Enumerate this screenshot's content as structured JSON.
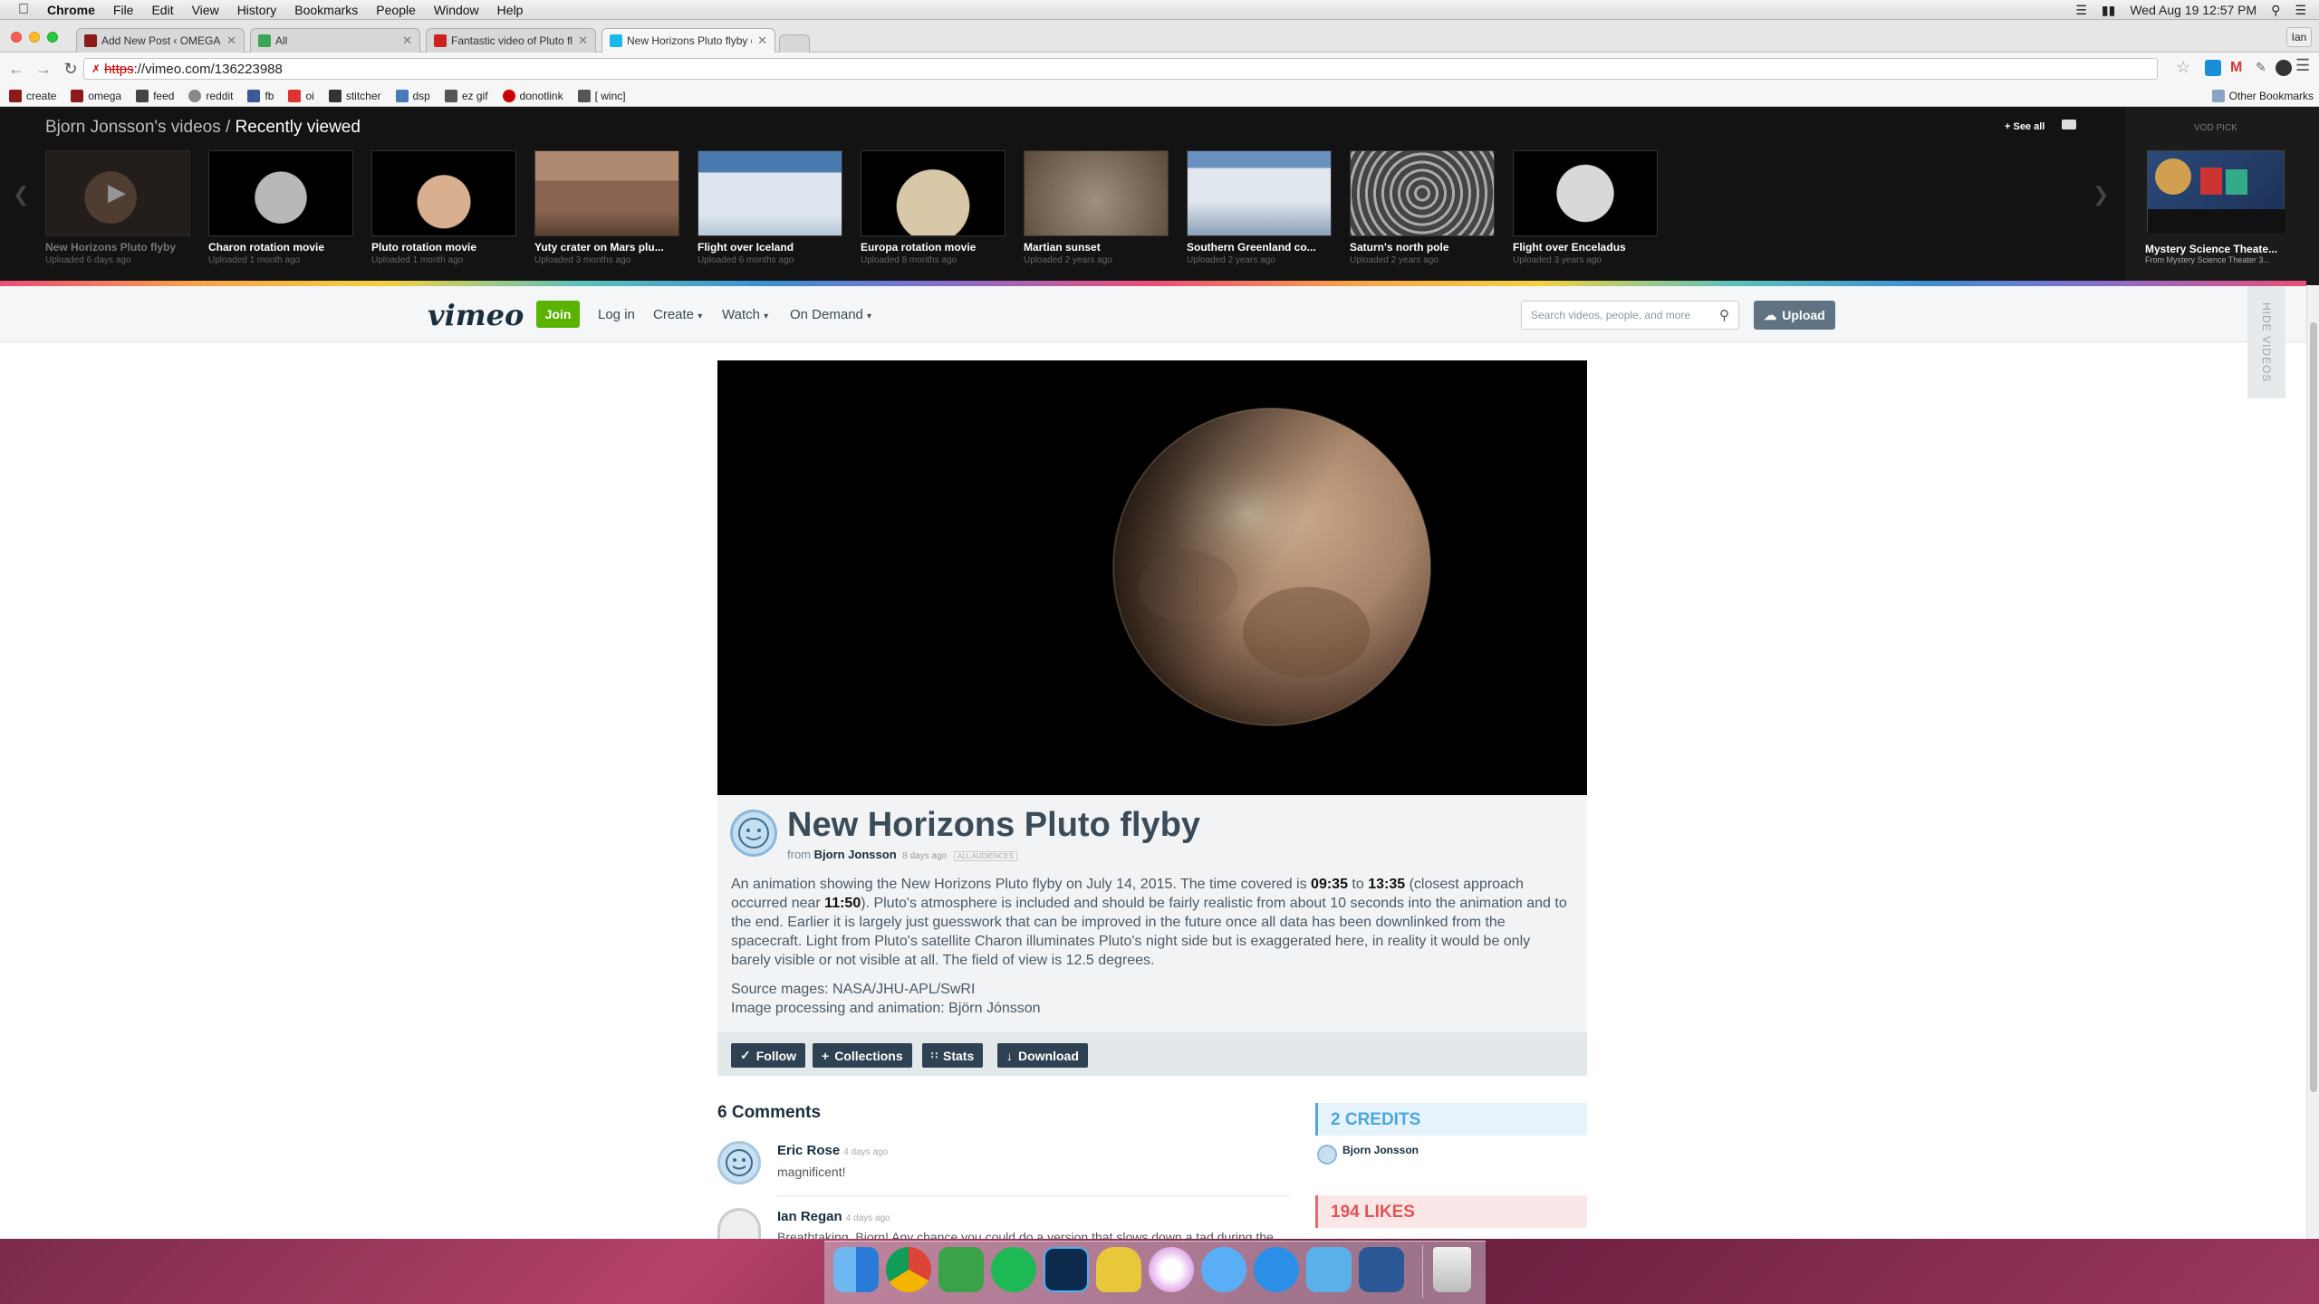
{
  "menubar": {
    "app": "Chrome",
    "items": [
      "File",
      "Edit",
      "View",
      "History",
      "Bookmarks",
      "People",
      "Window",
      "Help"
    ],
    "clock": "Wed Aug 19  12:57 PM"
  },
  "chrome": {
    "profile": "Ian",
    "tabs": [
      {
        "title": "Add New Post ‹ OMEGA-LI",
        "color": "#8b1a1a"
      },
      {
        "title": "All",
        "color": "#3aa655"
      },
      {
        "title": "Fantastic video of Pluto fly",
        "color": "#cc2222"
      },
      {
        "title": "New Horizons Pluto flyby o",
        "color": "#1ab7ea"
      }
    ],
    "url_scheme": "https",
    "url_rest": "://vimeo.com/136223988",
    "bookmarks": [
      {
        "label": "create",
        "color": "#8b1a1a"
      },
      {
        "label": "omega",
        "color": "#8b1a1a"
      },
      {
        "label": "feed",
        "color": "#444"
      },
      {
        "label": "reddit",
        "color": "#888"
      },
      {
        "label": "fb",
        "color": "#3b5998"
      },
      {
        "label": "oi",
        "color": "#d33"
      },
      {
        "label": "stitcher",
        "color": "#333"
      },
      {
        "label": "dsp",
        "color": "#4a7bb7"
      },
      {
        "label": "ez gif",
        "color": "#555"
      },
      {
        "label": "donotlink",
        "color": "#c00"
      },
      {
        "label": "[ winc]",
        "color": "#555"
      }
    ],
    "other_bookmarks": "Other Bookmarks"
  },
  "strip": {
    "owner": "Bjorn Jonsson's videos",
    "sep": " / ",
    "current": "Recently viewed",
    "see_all": "+ See all",
    "vod_label": "VOD PICK",
    "vod_title": "Mystery Science Theate...",
    "vod_from": "From Mystery Science Theater 3...",
    "videos": [
      {
        "title": "New Horizons Pluto flyby",
        "uploaded": "Uploaded 6 days ago",
        "style": "pluto-dim"
      },
      {
        "title": "Charon rotation movie",
        "uploaded": "Uploaded 1 month ago",
        "style": "charon"
      },
      {
        "title": "Pluto rotation movie",
        "uploaded": "Uploaded 1 month ago",
        "style": "pluto"
      },
      {
        "title": "Yuty crater on Mars plu...",
        "uploaded": "Uploaded 3 months ago",
        "style": "mars"
      },
      {
        "title": "Flight over Iceland",
        "uploaded": "Uploaded 6 months ago",
        "style": "iceland"
      },
      {
        "title": "Europa rotation movie",
        "uploaded": "Uploaded 8 months ago",
        "style": "europa"
      },
      {
        "title": "Martian sunset",
        "uploaded": "Uploaded 2 years ago",
        "style": "sunset"
      },
      {
        "title": "Southern Greenland co...",
        "uploaded": "Uploaded 2 years ago",
        "style": "greenland"
      },
      {
        "title": "Saturn's north pole",
        "uploaded": "Uploaded 2 years ago",
        "style": "saturn"
      },
      {
        "title": "Flight over Enceladus",
        "uploaded": "Uploaded 3 years ago",
        "style": "enceladus"
      }
    ]
  },
  "header": {
    "logo": "vimeo",
    "join": "Join",
    "login": "Log in",
    "create": "Create",
    "watch": "Watch",
    "on_demand": "On Demand",
    "search_placeholder": "Search videos, people, and more",
    "upload": "Upload",
    "hide_videos": "HIDE VIDEOS"
  },
  "video": {
    "title": "New Horizons Pluto flyby",
    "from": "from",
    "author": "Bjorn Jonsson",
    "ago": "8 days ago",
    "audience": "ALL AUDIENCES",
    "desc_1": "An animation showing the New Horizons Pluto flyby on July 14, 2015. The time covered is ",
    "t1": "09:35",
    "desc_2": " to ",
    "t2": "13:35",
    "desc_3": " (closest approach occurred near ",
    "t3": "11:50",
    "desc_4": "). Pluto's atmosphere is included and should be fairly realistic from about 10 seconds into the animation and to the end. Earlier it is largely just guesswork that can be improved in the future once all data has been downlinked from the spacecraft. Light from Pluto's satellite Charon illuminates Pluto's night side but is exaggerated here, in reality it would be only barely visible or not visible at all. The field of view is 12.5 degrees.",
    "source": "Source mages: NASA/JHU-APL/SwRI",
    "processing": "Image processing and animation: Björn Jónsson",
    "buttons": [
      "Follow",
      "Collections",
      "Stats",
      "Download"
    ]
  },
  "comments": {
    "heading": "6 Comments",
    "items": [
      {
        "name": "Eric Rose",
        "ago": "4 days ago",
        "text": "magnificent!"
      },
      {
        "name": "Ian Regan",
        "ago": "4 days ago",
        "text": "Breathtaking, Bjorn! Any chance you could do a version that slows down a tad during the"
      }
    ]
  },
  "sidebar": {
    "credits": "2 CREDITS",
    "credit_name": "Bjorn Jonsson",
    "likes": "194 LIKES"
  },
  "dock": {
    "apps": [
      "finder",
      "chrome",
      "evernote",
      "spotify",
      "photoshop",
      "cyberduck",
      "itunes",
      "messages",
      "app-store",
      "growl",
      "word",
      "trash"
    ]
  }
}
